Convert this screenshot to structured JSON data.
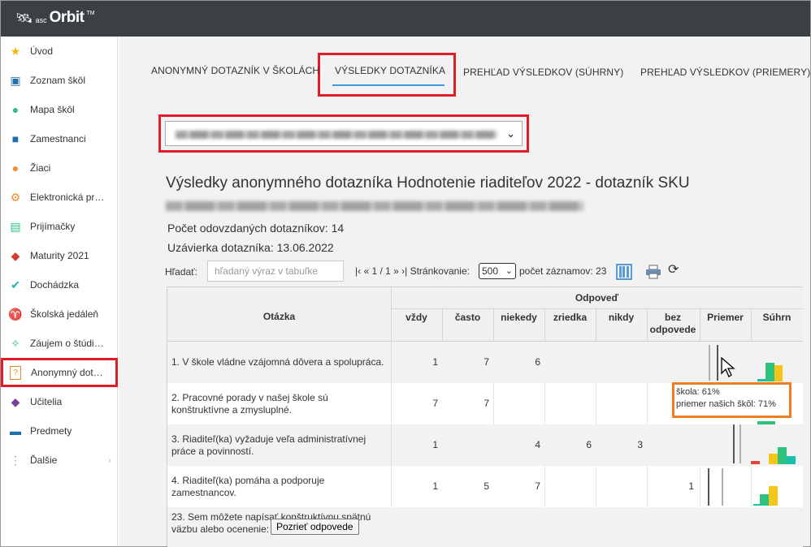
{
  "app": {
    "logo_small": "asc",
    "logo_big": "Orbit",
    "logo_tm": "TM"
  },
  "sidebar": {
    "items": [
      {
        "label": "Úvod",
        "icon": "star-icon"
      },
      {
        "label": "Zoznam škôl",
        "icon": "book-open-icon"
      },
      {
        "label": "Mapa škôl",
        "icon": "map-pin-icon"
      },
      {
        "label": "Zamestnanci",
        "icon": "briefcase-icon"
      },
      {
        "label": "Žiaci",
        "icon": "student-icon"
      },
      {
        "label": "Elektronická pr…",
        "icon": "electronic-book-icon"
      },
      {
        "label": "Prijímačky",
        "icon": "admission-icon"
      },
      {
        "label": "Maturity 2021",
        "icon": "graduation-cap-icon"
      },
      {
        "label": "Dochádzka",
        "icon": "attendance-check-icon"
      },
      {
        "label": "Školská jedáleň",
        "icon": "canteen-icon"
      },
      {
        "label": "Záujem o štúdi…",
        "icon": "compass-icon"
      },
      {
        "label": "Anonymný dot…",
        "icon": "questionnaire-icon"
      },
      {
        "label": "Učitelia",
        "icon": "teacher-icon"
      },
      {
        "label": "Predmety",
        "icon": "subjects-icon"
      },
      {
        "label": "Ďalšie",
        "icon": "more-dots-icon"
      }
    ]
  },
  "tabs": [
    {
      "label": "ANONYMNÝ DOTAZNÍK V ŠKOLÁCH"
    },
    {
      "label": "VÝSLEDKY DOTAZNÍKA"
    },
    {
      "label": "PREHĽAD VÝSLEDKOV (SÚHRNY)"
    },
    {
      "label": "PREHĽAD VÝSLEDKOV (PRIEMERY)"
    }
  ],
  "heading": "Výsledky anonymného dotazníka Hodnotenie riaditeľov 2022 - dotazník SKU",
  "info": {
    "submitted": "Počet odovzdaných dotazníkov: 14",
    "deadline": "Uzávierka dotazníka: 13.06.2022"
  },
  "toolbar": {
    "search_label": "Hľadať:",
    "search_placeholder": "hľadaný výraz v tabuľke",
    "pager": "|‹ « 1 / 1 » ›|  Stránkovanie:",
    "page_size": "500",
    "record_count": "počet záznamov: 23"
  },
  "table": {
    "headers": {
      "question": "Otázka",
      "answer_group": "Odpoveď",
      "cols": [
        "vždy",
        "často",
        "niekedy",
        "zriedka",
        "nikdy",
        "bez odpovede"
      ],
      "average": "Priemer",
      "summary": "Súhrn"
    },
    "rows": [
      {
        "q1": "1. V škole vládne vzájomná dôvera a spolupráca.",
        "q2": "",
        "vals": [
          "1",
          "7",
          "6",
          "",
          "",
          ""
        ]
      },
      {
        "q1": "2. Pracovné porady v našej škole sú",
        "q2": "konštruktívne a zmysluplné.",
        "vals": [
          "7",
          "7",
          "",
          "",
          "",
          ""
        ]
      },
      {
        "q1": "3. Riaditeľ(ka) vyžaduje veľa administratívnej",
        "q2": "práce a povinností.",
        "vals": [
          "1",
          "",
          "4",
          "6",
          "3",
          ""
        ]
      },
      {
        "q1": "4. Riaditeľ(ka) pomáha a podporuje",
        "q2": "zamestnancov.",
        "vals": [
          "1",
          "5",
          "7",
          "",
          "",
          "1"
        ]
      }
    ],
    "last_row": {
      "q1": "23. Sem môžete napísať konštruktívnu spätnú",
      "q2": "väzbu alebo ocenenie:",
      "button": "Pozrieť odpovede"
    }
  },
  "tooltip": {
    "line1": "škola: 61%",
    "line2": "priemer našich škôl: 71%"
  },
  "colors": {
    "accent_red": "#e21b2a",
    "tooltip_orange": "#ef7d22",
    "tab_blue": "#3a9bd9",
    "bar_green": "#2ec27e",
    "bar_yellow": "#f5c518",
    "bar_teal": "#19c2a8",
    "bar_red": "#e8453c"
  }
}
